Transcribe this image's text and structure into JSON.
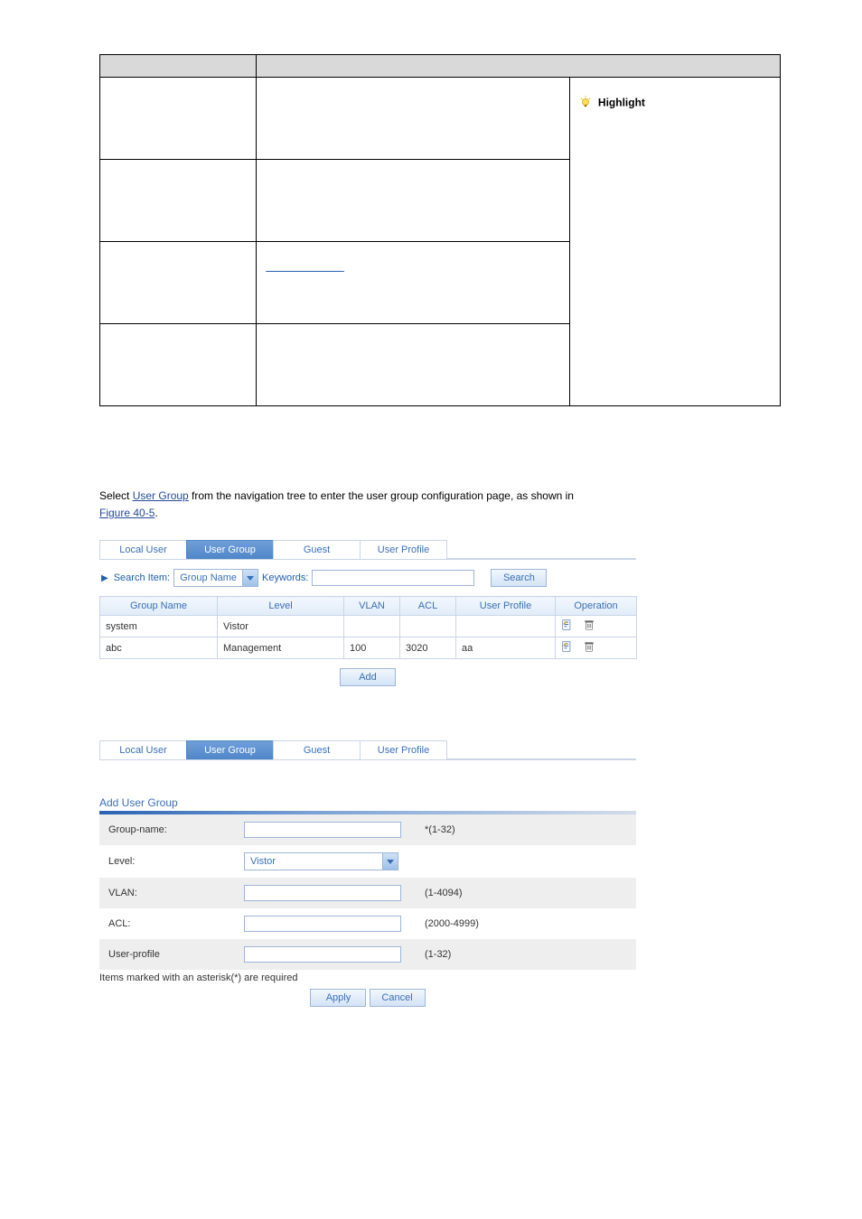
{
  "def_table": {
    "highlight_label": "Highlight",
    "link_placeholder": ""
  },
  "narrative": {
    "link1": "User Group",
    "text_mid": " from the navigation tree to enter the user group configuration page, as shown in ",
    "figlink1": "Figure 40-5",
    "period": ". "
  },
  "fig1": {
    "tabs": [
      "Local User",
      "User Group",
      "Guest",
      "User Profile"
    ],
    "active_tab_index": 1,
    "search_label": "Search Item:",
    "search_select": "Group Name",
    "keywords_label": "Keywords:",
    "keywords_value": "",
    "search_button": "Search",
    "columns": [
      "Group Name",
      "Level",
      "VLAN",
      "ACL",
      "User Profile",
      "Operation"
    ],
    "rows": [
      {
        "group_name": "system",
        "level": "Vistor",
        "vlan": "",
        "acl": "",
        "user_profile": ""
      },
      {
        "group_name": "abc",
        "level": "Management",
        "vlan": "100",
        "acl": "3020",
        "user_profile": "aa"
      }
    ],
    "add_button": "Add"
  },
  "fig2": {
    "tabs": [
      "Local User",
      "User Group",
      "Guest",
      "User Profile"
    ],
    "active_tab_index": 1,
    "panel_title": "Add User Group",
    "fields": {
      "group_name": {
        "label": "Group-name:",
        "hint": "*(1-32)",
        "value": ""
      },
      "level": {
        "label": "Level:",
        "select": "Vistor"
      },
      "vlan": {
        "label": "VLAN:",
        "hint": "(1-4094)",
        "value": ""
      },
      "acl": {
        "label": "ACL:",
        "hint": "(2000-4999)",
        "value": ""
      },
      "user_profile": {
        "label": "User-profile",
        "hint": "(1-32)",
        "value": ""
      }
    },
    "required_note": "Items marked with an asterisk(*) are required",
    "apply_button": "Apply",
    "cancel_button": "Cancel"
  }
}
